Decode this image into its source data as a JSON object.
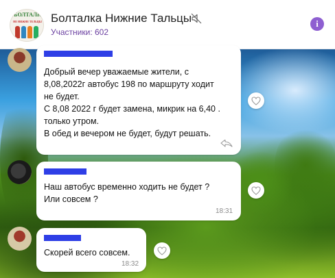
{
  "header": {
    "title": "Болталка Нижние Тальцы",
    "members": "Участники: 602",
    "logo_text": "БОЛТАЛК",
    "logo_subtext": "НЕ НИЖНЕ ТЕЛЬЦЫ",
    "info_symbol": "i"
  },
  "messages": [
    {
      "lines": [
        "Добрый вечер уважаемые жители, с",
        "8,08,2022г автобус 198 по маршруту ходит",
        "не будет.",
        "С 8,08 2022 г будет замена, микрик на 6,40 .",
        "только утром.",
        "В обед и вечером не будет, будут решать."
      ],
      "time": ""
    },
    {
      "lines": [
        "Наш автобус временно ходить не будет ?",
        "Или совсем ?"
      ],
      "time": "18:31"
    },
    {
      "lines": [
        "Скорей всего  совсем."
      ],
      "time": "18:32"
    }
  ],
  "colors": {
    "accent": "#8e5fd1",
    "members_text": "#6a3fa0",
    "redaction": "#2e3ee6"
  },
  "icons": [
    "mute-icon",
    "info-icon",
    "heart-icon",
    "share-icon"
  ]
}
